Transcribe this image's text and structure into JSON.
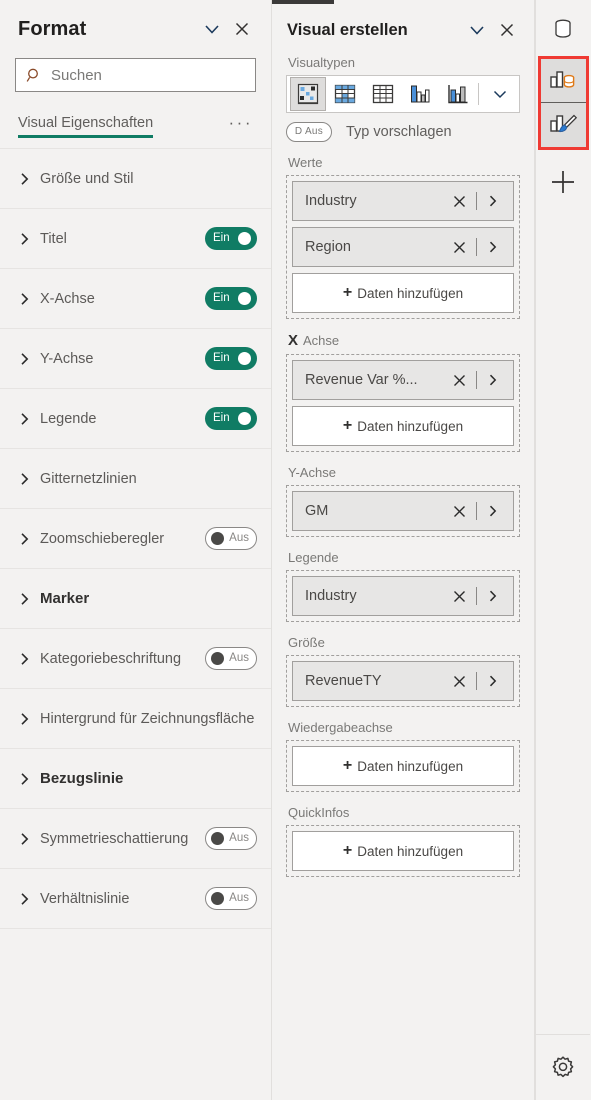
{
  "format_pane": {
    "title": "Format",
    "collapse_icon": "chevron-down-icon",
    "close_icon": "close-icon",
    "search": {
      "placeholder": "Suchen",
      "value": "",
      "icon": "search-icon"
    },
    "tab": {
      "label": "Visual Eigenschaften",
      "overflow_label": "···"
    },
    "accent_color": "#107c64",
    "properties": [
      {
        "label": "Größe und Stil",
        "toggle": null,
        "bold": false
      },
      {
        "label": "Titel",
        "toggle": "Ein",
        "toggle_state": "on",
        "bold": false
      },
      {
        "label": "X-Achse",
        "toggle": "Ein",
        "toggle_state": "on",
        "bold": false
      },
      {
        "label": "Y-Achse",
        "toggle": "Ein",
        "toggle_state": "on",
        "bold": false
      },
      {
        "label": "Legende",
        "toggle": "Ein",
        "toggle_state": "on",
        "bold": false
      },
      {
        "label": "Gitternetzlinien",
        "toggle": null,
        "bold": false
      },
      {
        "label": "Zoomschieberegler",
        "toggle": "Aus",
        "toggle_state": "off",
        "bold": false
      },
      {
        "label": "Marker",
        "toggle": null,
        "bold": true
      },
      {
        "label": "Kategoriebeschriftung",
        "toggle": "Aus",
        "toggle_state": "off",
        "bold": false
      },
      {
        "label": "Hintergrund für Zeichnungsfläche",
        "toggle": null,
        "bold": false
      },
      {
        "label": "Bezugslinie",
        "toggle": null,
        "bold": true
      },
      {
        "label": "Symmetrieschattierung",
        "toggle": "Aus",
        "toggle_state": "off",
        "bold": false
      },
      {
        "label": "Verhältnislinie",
        "toggle": "Aus",
        "toggle_state": "off",
        "bold": false
      }
    ]
  },
  "build_pane": {
    "title": "Visual erstellen",
    "collapse_icon": "chevron-down-icon",
    "close_icon": "close-icon",
    "visual_types_label": "Visualtypen",
    "visual_types": [
      {
        "name": "scatter-chart-icon",
        "selected": true
      },
      {
        "name": "matrix-table-icon",
        "selected": false
      },
      {
        "name": "table-icon",
        "selected": false
      },
      {
        "name": "clustered-column-chart-icon",
        "selected": false
      },
      {
        "name": "stacked-column-chart-icon",
        "selected": false
      }
    ],
    "visual_types_more_icon": "chevron-down-icon",
    "suggest": {
      "toggle_label": "D Aus",
      "toggle_state": "off",
      "text": "Typ vorschlagen"
    },
    "wells": [
      {
        "label": "Werte",
        "label_prefix": "",
        "fields": [
          "Industry",
          "Region"
        ],
        "add_label": "Daten hinzufügen"
      },
      {
        "label": "Achse",
        "label_prefix": "X",
        "fields": [
          "Revenue Var %..."
        ],
        "add_label": "Daten hinzufügen"
      },
      {
        "label": "Y-Achse",
        "label_prefix": "",
        "fields": [
          "GM"
        ],
        "add_label": null
      },
      {
        "label": "Legende",
        "label_prefix": "",
        "fields": [
          "Industry"
        ],
        "add_label": null
      },
      {
        "label": "Größe",
        "label_prefix": "",
        "fields": [
          "RevenueTY"
        ],
        "add_label": null
      },
      {
        "label": "Wiedergabeachse",
        "label_prefix": "",
        "fields": [],
        "add_label": "Daten hinzufügen"
      },
      {
        "label": "QuickInfos",
        "label_prefix": "",
        "fields": [],
        "add_label": "Daten hinzufügen"
      }
    ],
    "pill_remove_icon": "close-icon",
    "pill_expand_icon": "chevron-right-icon"
  },
  "rail": {
    "data_icon": "database-cylinder-icon",
    "build_visual_icon": "build-visual-icon",
    "format_visual_icon": "format-visual-paintbrush-icon",
    "add_icon": "plus-icon",
    "settings_icon": "gear-icon",
    "highlight_color": "#ef3a33"
  }
}
